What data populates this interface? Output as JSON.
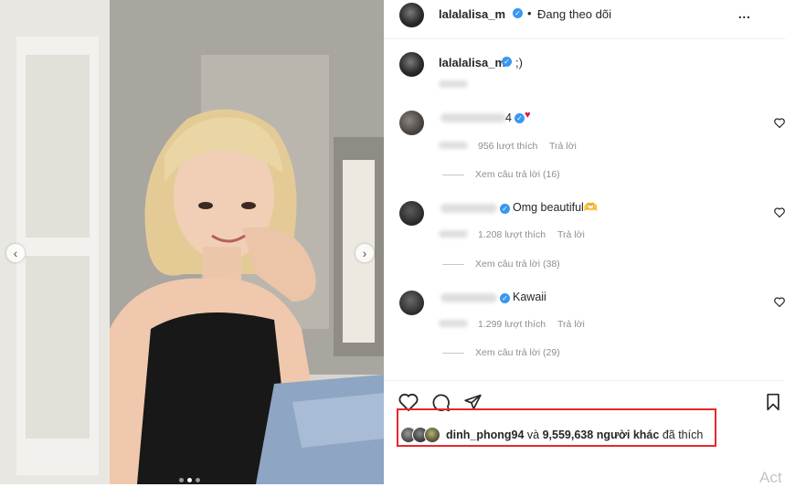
{
  "post": {
    "author": "lalalalisa_m",
    "separator": "•",
    "follow_status": "Đang theo dõi",
    "more_label": "...",
    "caption": ";)",
    "carousel": {
      "prev": "‹",
      "next": "›",
      "total": 3,
      "active": 1
    }
  },
  "comments": [
    {
      "text": "4",
      "emoji": "♥",
      "likes": "956 lượt thích",
      "reply": "Trả lời",
      "view_replies": "Xem câu trả lời (16)"
    },
    {
      "text": "Omg beautiful🫶",
      "emoji": "",
      "likes": "1.208 lượt thích",
      "reply": "Trả lời",
      "view_replies": "Xem câu trả lời (38)"
    },
    {
      "text": "Kawaii",
      "emoji": "",
      "likes": "1.299 lượt thích",
      "reply": "Trả lời",
      "view_replies": "Xem câu trả lời (29)"
    }
  ],
  "icons": {
    "like": "heart-icon",
    "comment": "comment-icon",
    "share": "share-icon",
    "save": "bookmark-icon",
    "comment_like": "heart-icon",
    "verified": "verified-badge-icon"
  },
  "likes": {
    "user": "dinh_phong94",
    "and": "và",
    "count": "9,559,638",
    "others": "người khác",
    "suffix": "đã thích"
  },
  "watermark": "Act",
  "colors": {
    "verified": "#3897f0",
    "highlight_box": "#e8282b",
    "text": "#262626",
    "muted": "#8e8e8e"
  }
}
